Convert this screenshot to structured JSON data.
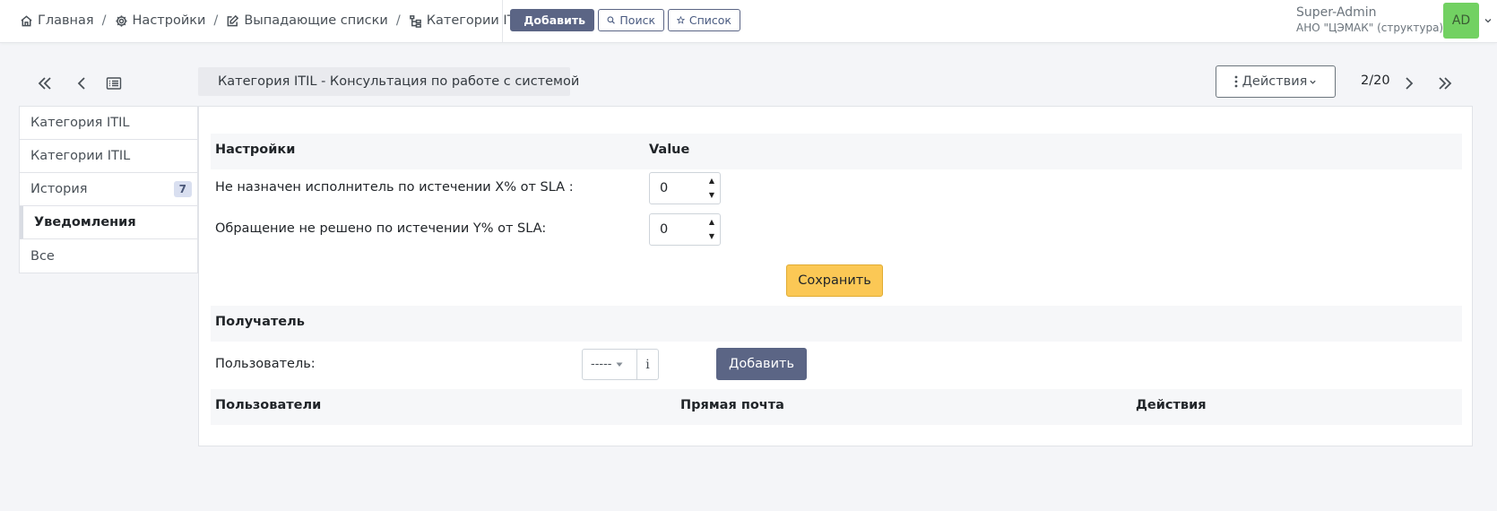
{
  "breadcrumb": {
    "items": [
      {
        "label": "Главная",
        "icon": "home-icon"
      },
      {
        "label": "Настройки",
        "icon": "gear-icon"
      },
      {
        "label": "Выпадающие списки",
        "icon": "edit-icon"
      },
      {
        "label": "Категории ITIL",
        "icon": "hierarchy-icon"
      }
    ],
    "separator": "/"
  },
  "toolbar": {
    "add_label": "Добавить",
    "search_label": "Поиск",
    "list_label": "Список"
  },
  "user": {
    "name": "Super-Admin",
    "org": "АНО \"ЦЭМАК\" (структура)",
    "initials": "AD",
    "avatar_color": "#72d162"
  },
  "record": {
    "title": "Категория ITIL - Консультация по работе с системой",
    "actions_label": "Действия",
    "pager": "2/20"
  },
  "sidebar": {
    "items": [
      {
        "label": "Категория ITIL"
      },
      {
        "label": "Категории ITIL"
      },
      {
        "label": "История",
        "badge": "7"
      },
      {
        "label": "Уведомления",
        "active": true
      },
      {
        "label": "Все"
      }
    ]
  },
  "settings": {
    "col_settings": "Настройки",
    "col_value": "Value",
    "rows": [
      {
        "label": "Не назначен исполнитель по истечении X% от SLA :",
        "value": "0"
      },
      {
        "label": "Обращение не решено по истечении Y% от SLA:",
        "value": "0"
      }
    ],
    "save_label": "Сохранить"
  },
  "recipient": {
    "title": "Получатель",
    "user_label": "Пользователь:",
    "select_value": "-----",
    "info_label": "i",
    "add_label": "Добавить",
    "table_headers": [
      "Пользователи",
      "Прямая почта",
      "Действия"
    ]
  },
  "colors": {
    "primary": "#5b6585",
    "save": "#fbc855",
    "background": "#f4f5f8"
  }
}
